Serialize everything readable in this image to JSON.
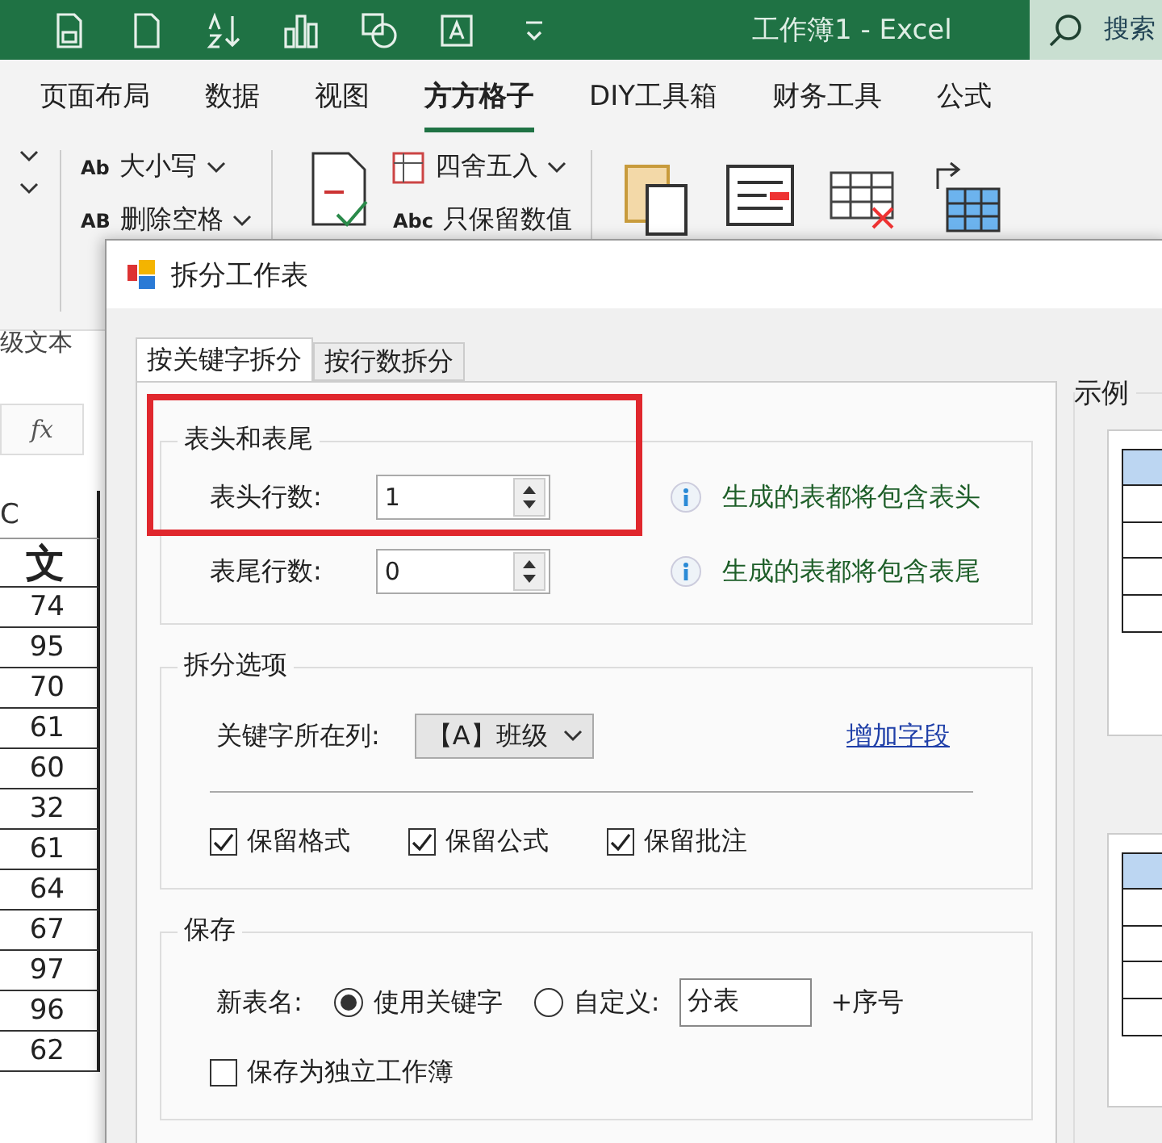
{
  "title_bar": {
    "title": "工作簿1  -  Excel",
    "search": "搜索"
  },
  "ribbon_tabs": [
    {
      "label": "页面布局",
      "selected": false
    },
    {
      "label": "数据",
      "selected": false
    },
    {
      "label": "视图",
      "selected": false
    },
    {
      "label": "方方格子",
      "selected": true
    },
    {
      "label": "DIY工具箱",
      "selected": false
    },
    {
      "label": "财务工具",
      "selected": false
    },
    {
      "label": "公式",
      "selected": false
    }
  ],
  "ribbon": {
    "text_buttons": [
      {
        "label": "大小写",
        "glyph": "Ab"
      },
      {
        "label": "删除空格",
        "glyph": "AB"
      }
    ],
    "number_buttons": [
      {
        "label": "四舍五入"
      },
      {
        "label": "只保留数值",
        "glyph": "Abc"
      }
    ],
    "group_label": "级文本"
  },
  "sheet": {
    "formula_label": "fx",
    "column_header": "C",
    "cells": [
      "文",
      "74",
      "95",
      "70",
      "61",
      "60",
      "32",
      "61",
      "64",
      "67",
      "97",
      "96",
      "62"
    ]
  },
  "dialog": {
    "title": "拆分工作表",
    "tabs": [
      {
        "label": "按关键字拆分",
        "selected": true
      },
      {
        "label": "按行数拆分",
        "selected": false
      }
    ],
    "header_footer": {
      "legend": "表头和表尾",
      "fields": [
        {
          "label": "表头行数:",
          "value": "1",
          "hint": "生成的表都将包含表头"
        },
        {
          "label": "表尾行数:",
          "value": "0",
          "hint": "生成的表都将包含表尾"
        }
      ]
    },
    "split_options": {
      "legend": "拆分选项",
      "key_column_label": "关键字所在列:",
      "key_column_value": "【A】班级",
      "add_field_link": "增加字段",
      "checkboxes": [
        {
          "label": "保留格式",
          "checked": true
        },
        {
          "label": "保留公式",
          "checked": true
        },
        {
          "label": "保留批注",
          "checked": true
        }
      ]
    },
    "save": {
      "legend": "保存",
      "name_label": "新表名:",
      "radios": [
        {
          "label": "使用关键字",
          "selected": true
        },
        {
          "label": "自定义:",
          "selected": false
        }
      ],
      "custom_name": "分表",
      "suffix": "+序号",
      "checkboxes": [
        {
          "label": "保存为独立工作簿",
          "checked": false
        }
      ]
    },
    "example": {
      "legend": "示例"
    }
  }
}
